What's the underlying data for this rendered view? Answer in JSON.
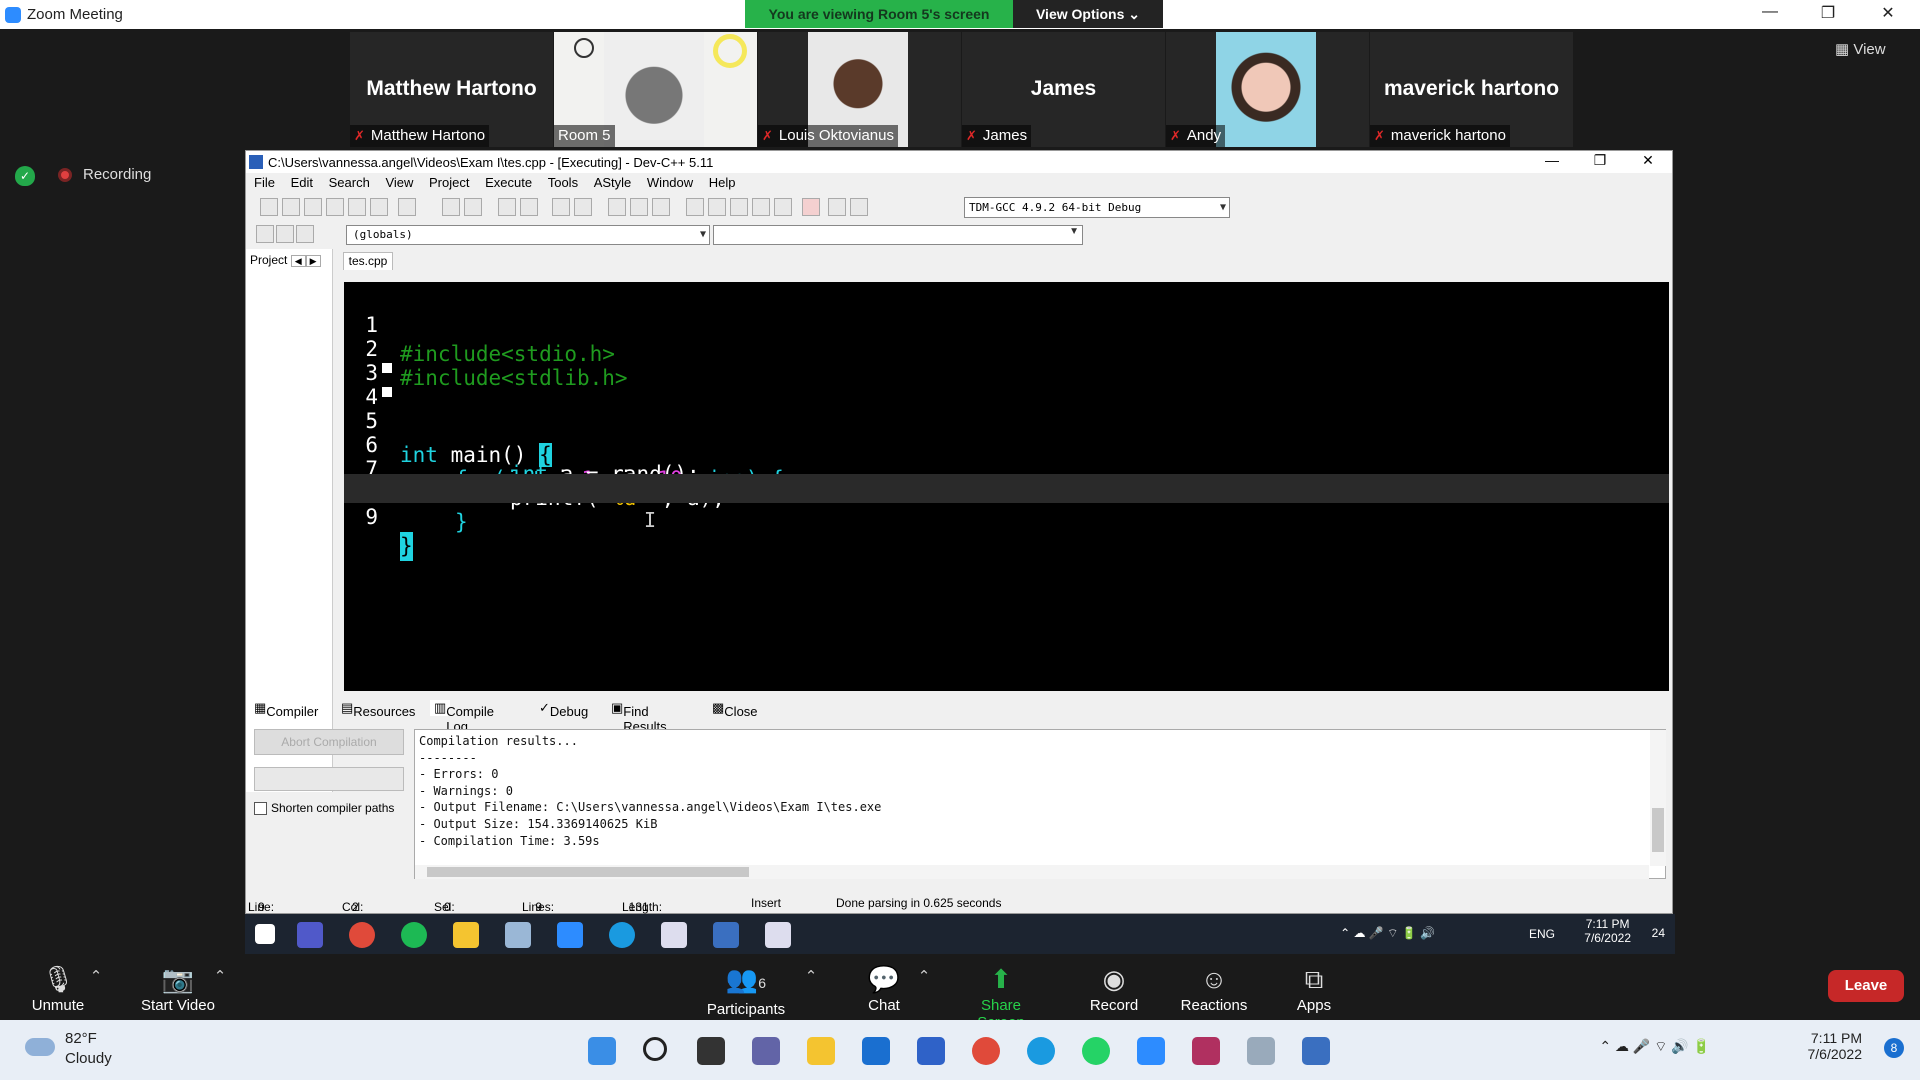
{
  "zoom": {
    "window_title": "Zoom Meeting",
    "banner": "You are viewing Room 5's screen",
    "view_options": "View Options ⌄",
    "view_button": "View",
    "recording": "Recording"
  },
  "participants": [
    {
      "big_name": "Matthew Hartono",
      "label": "Matthew Hartono",
      "video": false
    },
    {
      "big_name": "",
      "label": "Room 5",
      "video": true
    },
    {
      "big_name": "",
      "label": "Louis Oktovianus",
      "video": true
    },
    {
      "big_name": "James",
      "label": "James",
      "video": false
    },
    {
      "big_name": "",
      "label": "Andy",
      "video": true
    },
    {
      "big_name": "maverick hartono",
      "label": "maverick hartono",
      "video": false
    }
  ],
  "devcpp": {
    "title": "C:\\Users\\vannessa.angel\\Videos\\Exam I\\tes.cpp - [Executing] - Dev-C++ 5.11",
    "menu": [
      "File",
      "Edit",
      "Search",
      "View",
      "Project",
      "Execute",
      "Tools",
      "AStyle",
      "Window",
      "Help"
    ],
    "compiler": "TDM-GCC 4.9.2 64-bit Debug",
    "scope": "(globals)",
    "project_tab": "Project",
    "file_tab": "tes.cpp",
    "code_lines": [
      {
        "n": "1"
      },
      {
        "n": "2"
      },
      {
        "n": "3"
      },
      {
        "n": "4"
      },
      {
        "n": "5"
      },
      {
        "n": "6"
      },
      {
        "n": "7"
      },
      {
        "n": "8"
      },
      {
        "n": "9"
      }
    ],
    "code_text": {
      "l1": "#include<stdio.h>",
      "l2": "#include<stdlib.h>",
      "l4_kw": "int",
      "l4_rest": " main() ",
      "l4_brace": "{",
      "l5_kw": "for",
      "l5_a": "(",
      "l5_int": "int",
      "l5_b": " i=",
      "l5_one": "1",
      "l5_c": "; i<=",
      "l5_ten": "10",
      "l5_d": "; i++) {",
      "l6_kw": "int",
      "l6_rest": " a = rand();",
      "l7_a": "printf(",
      "l7_str": "\"%d \"",
      "l7_b": ", a);",
      "l8": "}",
      "l9": "}"
    },
    "bottom_tabs": [
      "Compiler",
      "Resources",
      "Compile Log",
      "Debug",
      "Find Results",
      "Close"
    ],
    "abort_button": "Abort Compilation",
    "shorten_paths": "Shorten compiler paths",
    "log": "Compilation results...\n--------\n- Errors: 0\n- Warnings: 0\n- Output Filename: C:\\Users\\vannessa.angel\\Videos\\Exam I\\tes.exe\n- Output Size: 154.3369140625 KiB\n- Compilation Time: 3.59s",
    "status": {
      "line_label": "Line:",
      "line": "9",
      "col_label": "Col:",
      "col": "2",
      "sel_label": "Sel:",
      "sel": "0",
      "lines_label": "Lines:",
      "lines": "9",
      "length_label": "Length:",
      "length": "131",
      "mode": "Insert",
      "message": "Done parsing in 0.625 seconds"
    }
  },
  "inner_taskbar": {
    "lang": "ENG",
    "time": "7:11 PM",
    "date": "7/6/2022",
    "notif": "24"
  },
  "controls": {
    "unmute": "Unmute",
    "start_video": "Start Video",
    "participants": "Participants",
    "participants_count": "6",
    "chat": "Chat",
    "share_screen": "Share Screen",
    "record": "Record",
    "reactions": "Reactions",
    "apps": "Apps",
    "leave": "Leave"
  },
  "windows_taskbar": {
    "temp": "82°F",
    "weather": "Cloudy",
    "time": "7:11 PM",
    "date": "7/6/2022",
    "notif": "8"
  }
}
